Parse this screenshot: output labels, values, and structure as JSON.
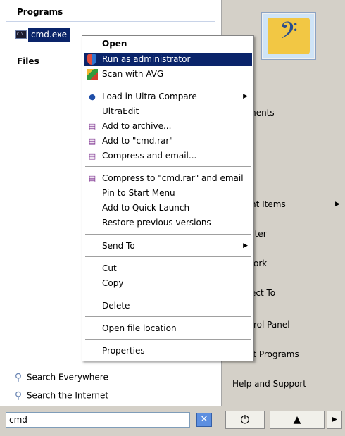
{
  "start_menu": {
    "programs_heading": "Programs",
    "files_heading": "Files",
    "program_result": "cmd.exe",
    "search_everywhere": "Search Everywhere",
    "search_internet": "Search the Internet",
    "search_value": "cmd",
    "right_pane": {
      "documents_partial": "ments",
      "recent_items_partial": "nt Items",
      "computer_partial": "uter",
      "network_partial": "ork",
      "connect_to_partial": "ect To",
      "control_panel_partial": "rol Panel",
      "default_programs_partial": "lt Programs",
      "help_support": "Help and Support"
    },
    "accent_color": "#0a246a"
  },
  "context_menu": {
    "items": [
      {
        "label": "Open"
      },
      {
        "label": "Run as administrator"
      },
      {
        "label": "Scan with AVG"
      },
      {
        "label": "Load in Ultra Compare"
      },
      {
        "label": "UltraEdit"
      },
      {
        "label": "Add to archive..."
      },
      {
        "label": "Add to \"cmd.rar\""
      },
      {
        "label": "Compress and email..."
      },
      {
        "label": "Compress to \"cmd.rar\" and email"
      },
      {
        "label": "Pin to Start Menu"
      },
      {
        "label": "Add to Quick Launch"
      },
      {
        "label": "Restore previous versions"
      },
      {
        "label": "Send To"
      },
      {
        "label": "Cut"
      },
      {
        "label": "Copy"
      },
      {
        "label": "Delete"
      },
      {
        "label": "Open file location"
      },
      {
        "label": "Properties"
      }
    ]
  }
}
